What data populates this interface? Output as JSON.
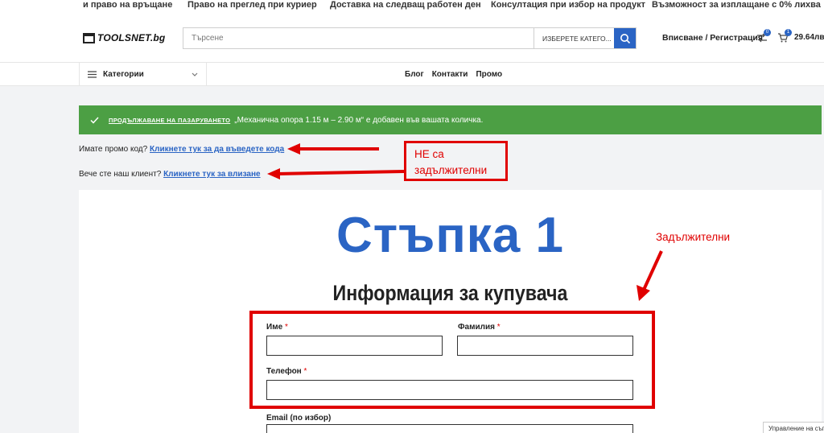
{
  "topbar": {
    "items": [
      "и право на връщане",
      "Право на преглед при куриер",
      "Доставка на следващ работен ден",
      "Консултация при избор на продукт",
      "Възможност за изплащане с 0% лихва"
    ]
  },
  "header": {
    "logo_text": "TOOLSNET.bg",
    "search_placeholder": "Търсене",
    "category_select": "ИЗБЕРЕТЕ КАТЕГО...",
    "login_label": "Вписване / Регистрация",
    "compare_count": "0",
    "cart_count": "1",
    "cart_total": "29.64лв."
  },
  "nav": {
    "categories_label": "Категории",
    "links": [
      "Блог",
      "Контакти",
      "Промо"
    ]
  },
  "notice": {
    "continue_label": "ПРОДЪЛЖАВАНЕ НА ПАЗАРУВАНЕТО",
    "message": "„Механична опора 1.15 м – 2.90 м“ е добавен във вашата количка."
  },
  "promo": {
    "question": "Имате промо код?",
    "link": "Кликнете тук за да въведете кода"
  },
  "client": {
    "question": "Вече сте наш клиент?",
    "link": "Кликнете тук за влизане"
  },
  "annotations": {
    "optional_line1": "НЕ са",
    "optional_line2": "задължителни",
    "required": "Задължителни",
    "color": "#e00000"
  },
  "checkout": {
    "step_title": "Стъпка 1",
    "section_title": "Информация за купувача",
    "first_name_label": "Име",
    "last_name_label": "Фамилия",
    "phone_label": "Телефон",
    "required_mark": "*",
    "email_label": "Email (по избор)",
    "first_name_value": "",
    "last_name_value": "",
    "phone_value": ""
  },
  "cookie": {
    "label": "Управление на съгл"
  },
  "colors": {
    "brand": "#2a64c4",
    "success": "#4c9f44",
    "alert": "#e00000"
  }
}
